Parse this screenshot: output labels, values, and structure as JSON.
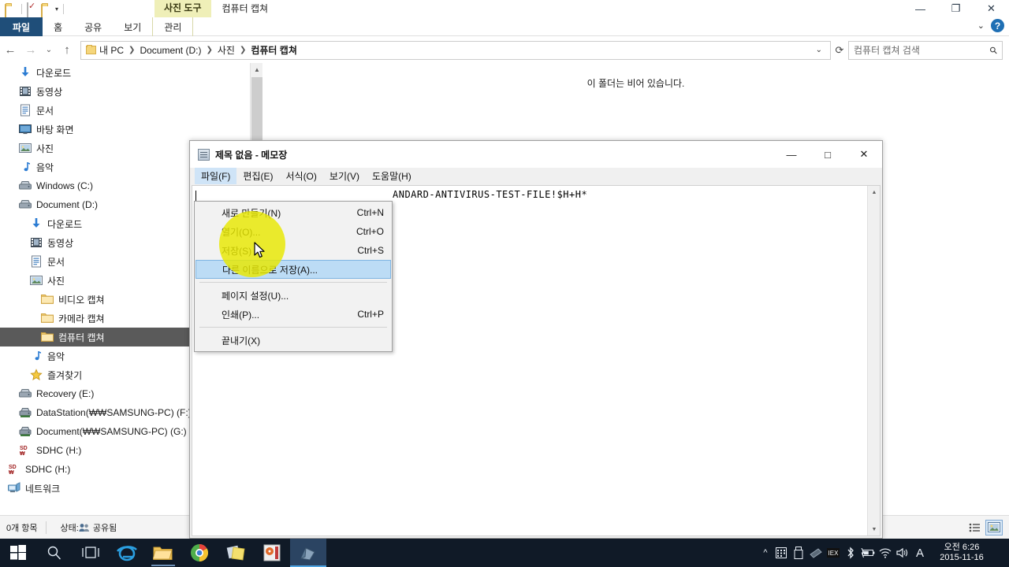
{
  "explorer": {
    "window_title": "컴퓨터 캡쳐",
    "contextual_tab_group": "사진 도구",
    "quick_access": [
      {
        "name": "new-folder",
        "icon": "folder-icon"
      },
      {
        "name": "properties",
        "icon": "checkbox-icon"
      },
      {
        "name": "new-item",
        "icon": "folder-icon"
      },
      {
        "name": "customize",
        "icon": "chevron-down-icon"
      }
    ],
    "window_buttons": {
      "minimize": "—",
      "maximize": "❐",
      "close": "✕"
    },
    "ribbon_tabs": [
      {
        "label": "파일",
        "selected": true
      },
      {
        "label": "홈",
        "selected": false
      },
      {
        "label": "공유",
        "selected": false
      },
      {
        "label": "보기",
        "selected": false
      },
      {
        "label": "관리",
        "selected": false,
        "contextual": true
      }
    ],
    "ribbon_collapse_icon": "chevron-down-icon",
    "help_icon": "question-mark-icon",
    "navigation": {
      "back_icon": "arrow-left-icon",
      "forward_icon": "arrow-right-icon",
      "recent_icon": "chevron-down-icon",
      "up_icon": "arrow-up-icon",
      "refresh_icon": "refresh-icon",
      "address_dropdown_icon": "chevron-down-icon"
    },
    "breadcrumbs": [
      "내 PC",
      "Document (D:)",
      "사진",
      "컴퓨터 캡쳐"
    ],
    "search": {
      "placeholder": "컴퓨터 캡쳐 검색",
      "icon": "search-icon"
    },
    "sidebar": [
      {
        "label": "다운로드",
        "icon": "download-icon",
        "indent": 1,
        "selected": false
      },
      {
        "label": "동영상",
        "icon": "video-icon",
        "indent": 1,
        "selected": false
      },
      {
        "label": "문서",
        "icon": "document-icon",
        "indent": 1,
        "selected": false
      },
      {
        "label": "바탕 화면",
        "icon": "desktop-icon",
        "indent": 1,
        "selected": false
      },
      {
        "label": "사진",
        "icon": "picture-icon",
        "indent": 1,
        "selected": false
      },
      {
        "label": "음악",
        "icon": "music-icon",
        "indent": 1,
        "selected": false
      },
      {
        "label": "Windows (C:)",
        "icon": "drive-icon",
        "indent": 1,
        "selected": false
      },
      {
        "label": "Document (D:)",
        "icon": "drive-icon",
        "indent": 1,
        "selected": false
      },
      {
        "label": "다운로드",
        "icon": "download-icon",
        "indent": 2,
        "selected": false
      },
      {
        "label": "동영상",
        "icon": "video-icon",
        "indent": 2,
        "selected": false
      },
      {
        "label": "문서",
        "icon": "document-icon",
        "indent": 2,
        "selected": false
      },
      {
        "label": "사진",
        "icon": "picture-icon",
        "indent": 2,
        "selected": false
      },
      {
        "label": "비디오 캡쳐",
        "icon": "folder-icon",
        "indent": 3,
        "selected": false
      },
      {
        "label": "카메라 캡쳐",
        "icon": "folder-icon",
        "indent": 3,
        "selected": false
      },
      {
        "label": "컴퓨터 캡쳐",
        "icon": "folder-icon",
        "indent": 3,
        "selected": true
      },
      {
        "label": "음악",
        "icon": "music-icon",
        "indent": 2,
        "selected": false
      },
      {
        "label": "즐겨찾기",
        "icon": "star-icon",
        "indent": 2,
        "selected": false
      },
      {
        "label": "Recovery (E:)",
        "icon": "drive-icon",
        "indent": 1,
        "selected": false
      },
      {
        "label": "DataStation(₩₩SAMSUNG-PC) (F:)",
        "icon": "network-drive-icon",
        "indent": 1,
        "selected": false
      },
      {
        "label": "Document(₩₩SAMSUNG-PC) (G:)",
        "icon": "network-drive-icon",
        "indent": 1,
        "selected": false
      },
      {
        "label": "SDHC (H:)",
        "icon": "sd-card-icon",
        "indent": 1,
        "selected": false
      },
      {
        "label": "SDHC (H:)",
        "icon": "sd-card-icon",
        "indent": 0,
        "selected": false
      },
      {
        "label": "네트워크",
        "icon": "network-icon",
        "indent": 0,
        "selected": false
      }
    ],
    "content_empty_message": "이 폴더는 비어 있습니다.",
    "status_bar": {
      "item_count": "0개 항목",
      "state_label": "상태:",
      "state_value": "공유됨",
      "state_icon": "shared-users-icon",
      "view_details_icon": "details-view-icon",
      "view_large_icon": "large-icons-view-icon"
    }
  },
  "notepad": {
    "title": "제목 없음 - 메모장",
    "icon": "notepad-icon",
    "window_buttons": {
      "minimize": "—",
      "maximize": "□",
      "close": "✕"
    },
    "menubar": [
      {
        "label": "파일(F)",
        "open": true
      },
      {
        "label": "편집(E)",
        "open": false
      },
      {
        "label": "서식(O)",
        "open": false
      },
      {
        "label": "보기(V)",
        "open": false
      },
      {
        "label": "도움말(H)",
        "open": false
      }
    ],
    "text_content": "ANDARD-ANTIVIRUS-TEST-FILE!$H+H*",
    "scrollbar": {
      "up_icon": "chevron-up-icon",
      "down_icon": "chevron-down-icon"
    },
    "file_menu": [
      {
        "label": "새로 만들기(N)",
        "accel": "Ctrl+N",
        "highlighted": false,
        "separator_after": false
      },
      {
        "label": "열기(O)...",
        "accel": "Ctrl+O",
        "highlighted": false,
        "separator_after": false
      },
      {
        "label": "저장(S)",
        "accel": "Ctrl+S",
        "highlighted": false,
        "separator_after": false
      },
      {
        "label": "다른 이름으로 저장(A)...",
        "accel": "",
        "highlighted": true,
        "separator_after": true
      },
      {
        "label": "페이지 설정(U)...",
        "accel": "",
        "highlighted": false,
        "separator_after": false
      },
      {
        "label": "인쇄(P)...",
        "accel": "Ctrl+P",
        "highlighted": false,
        "separator_after": true
      },
      {
        "label": "끝내기(X)",
        "accel": "",
        "highlighted": false,
        "separator_after": false
      }
    ]
  },
  "taskbar": {
    "start_icon": "windows-start-icon",
    "buttons": [
      {
        "name": "search-icon",
        "running": false,
        "active": false
      },
      {
        "name": "task-view-icon",
        "running": false,
        "active": false
      },
      {
        "name": "internet-explorer-icon",
        "running": false,
        "active": false
      },
      {
        "name": "file-explorer-icon",
        "running": true,
        "active": false
      },
      {
        "name": "google-chrome-icon",
        "running": false,
        "active": false
      },
      {
        "name": "sticky-notes-icon",
        "running": false,
        "active": false
      },
      {
        "name": "media-app-icon",
        "running": false,
        "active": false
      },
      {
        "name": "notepad-icon",
        "running": true,
        "active": true
      }
    ],
    "tray": [
      {
        "name": "show-hidden-icons-icon",
        "glyph": "^"
      },
      {
        "name": "calendar-icon"
      },
      {
        "name": "usb-icon"
      },
      {
        "name": "device-icon"
      },
      {
        "name": "ime-mode-icon"
      },
      {
        "name": "bluetooth-icon"
      },
      {
        "name": "battery-icon"
      },
      {
        "name": "wifi-icon"
      },
      {
        "name": "volume-icon"
      },
      {
        "name": "ime-language-icon",
        "glyph": "A"
      }
    ],
    "clock": {
      "time": "오전 6:26",
      "date": "2015-11-16"
    }
  },
  "colors": {
    "accent": "#1f4e79",
    "selection": "#bcdcf5",
    "contextual_tab": "#efefb8",
    "taskbar": "#101a27",
    "click_highlight": "#e8e800"
  }
}
